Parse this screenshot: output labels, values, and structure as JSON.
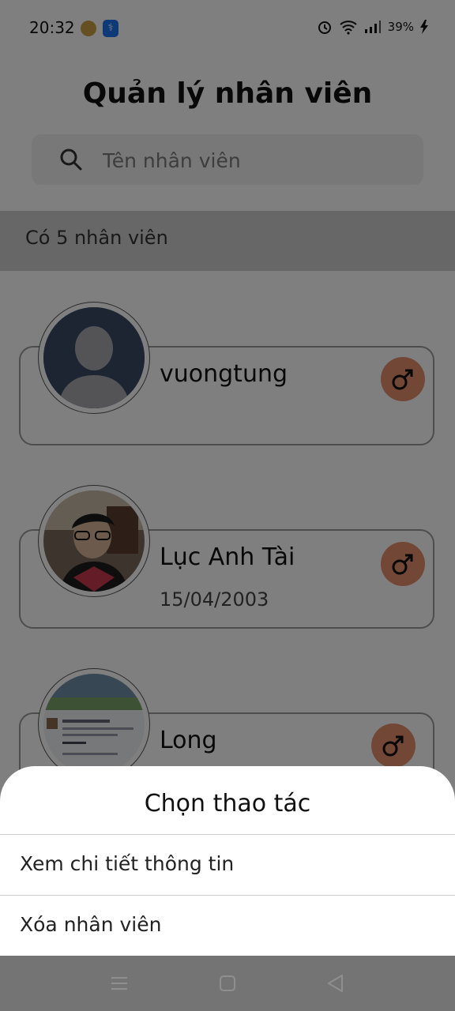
{
  "status_bar": {
    "time": "20:32",
    "battery": "39%"
  },
  "title": "Quản lý nhân viên",
  "search": {
    "placeholder": "Tên nhân viên"
  },
  "count_text": "Có 5 nhân viên",
  "employees": [
    {
      "name": "vuongtung",
      "dob": "",
      "gender": "male"
    },
    {
      "name": "Lục Anh Tài",
      "dob": "15/04/2003",
      "gender": "male"
    },
    {
      "name": "Long",
      "dob": "",
      "gender": "male"
    }
  ],
  "sheet": {
    "title": "Chọn thao tác",
    "options": [
      "Xem chi tiết thông tin",
      "Xóa nhân viên"
    ]
  },
  "colors": {
    "gender_badge": "#e58f6c",
    "overlay": "#000000"
  }
}
